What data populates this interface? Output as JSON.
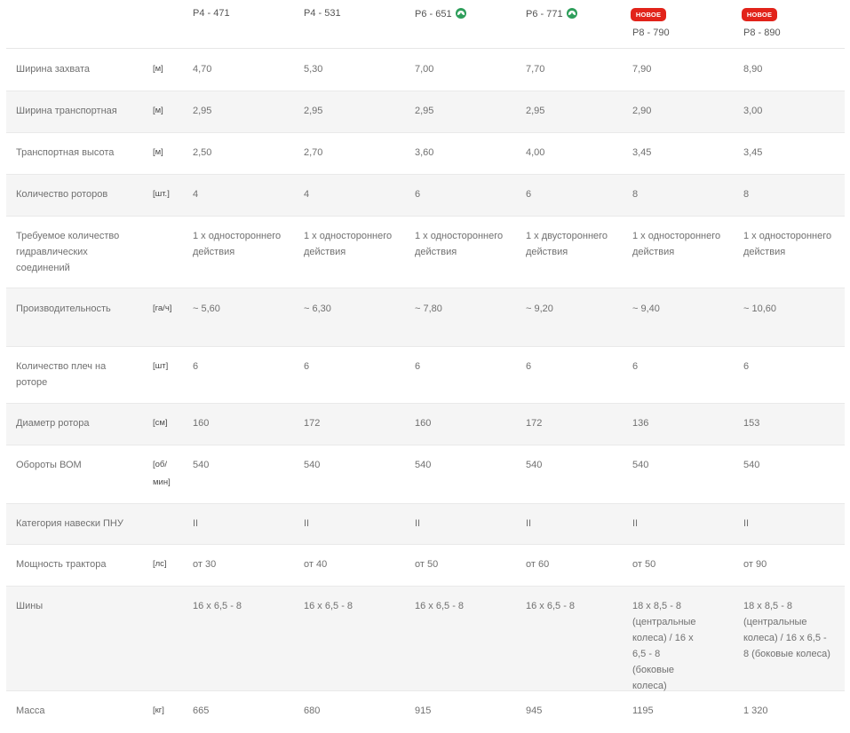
{
  "models": [
    {
      "name": "P4 - 471",
      "eco": false,
      "new": false
    },
    {
      "name": "P4 - 531",
      "eco": false,
      "new": false
    },
    {
      "name": "P6 - 651",
      "eco": true,
      "new": false
    },
    {
      "name": "P6 - 771",
      "eco": true,
      "new": false
    },
    {
      "name": "P8 - 790",
      "eco": false,
      "new": true
    },
    {
      "name": "P8 - 890",
      "eco": false,
      "new": true
    }
  ],
  "new_badge_label": "НОВОЕ",
  "eco_icon": "leaf-icon",
  "accent_colors": {
    "badge": "#e2231a",
    "eco": "#2e9e5b"
  },
  "rows": [
    {
      "label": "Ширина захвата",
      "unit": "[м]",
      "values": [
        "4,70",
        "5,30",
        "7,00",
        "7,70",
        "7,90",
        "8,90"
      ]
    },
    {
      "label": "Ширина транспортная",
      "unit": "[м]",
      "values": [
        "2,95",
        "2,95",
        "2,95",
        "2,95",
        "2,90",
        "3,00"
      ]
    },
    {
      "label": "Транспортная высота",
      "unit": "[м]",
      "values": [
        "2,50",
        "2,70",
        "3,60",
        "4,00",
        "3,45",
        "3,45"
      ]
    },
    {
      "label": "Количество роторов",
      "unit": "[шт.]",
      "values": [
        "4",
        "4",
        "6",
        "6",
        "8",
        "8"
      ]
    },
    {
      "label": "Требуемое количество гидравлических соединений",
      "unit": "",
      "values": [
        "1 x одностороннего действия",
        "1 x одностороннего действия",
        "1 x одностороннего действия",
        "1 x двустороннего действия",
        "1 x одностороннего действия",
        "1 x одностороннего действия"
      ]
    },
    {
      "label": "Производительность",
      "unit": "[га/ч]",
      "values": [
        "~ 5,60",
        "~ 6,30",
        "~ 7,80",
        "~ 9,20",
        "~ 9,40",
        "~ 10,60"
      ]
    },
    {
      "label": "Количество плеч на роторе",
      "unit": "[шт]",
      "values": [
        "6",
        "6",
        "6",
        "6",
        "6",
        "6"
      ]
    },
    {
      "label": "Диаметр ротора",
      "unit": "[см]",
      "values": [
        "160",
        "172",
        "160",
        "172",
        "136",
        "153"
      ]
    },
    {
      "label": "Обороты ВОМ",
      "unit": "[об/мин]",
      "values": [
        "540",
        "540",
        "540",
        "540",
        "540",
        "540"
      ]
    },
    {
      "label": "Категория навески ПНУ",
      "unit": "",
      "values": [
        "II",
        "II",
        "II",
        "II",
        "II",
        "II"
      ]
    },
    {
      "label": "Мощность трактора",
      "unit": "[лс]",
      "values": [
        "от 30",
        "от 40",
        "от 50",
        "от 60",
        "от 50",
        "от 90"
      ]
    },
    {
      "label": "Шины",
      "unit": "",
      "values": [
        "16 x 6,5 - 8",
        "16 x 6,5 - 8",
        "16 x 6,5 - 8",
        "16 x 6,5 - 8",
        "18 x 8,5 - 8 (центральные колеса) / 16 x 6,5 - 8 (боковые колеса)",
        "18 x 8,5 - 8 (центральные колеса) / 16 x 6,5 - 8 (боковые колеса)"
      ]
    },
    {
      "label": "Масса",
      "unit": "[кг]",
      "values": [
        "665",
        "680",
        "915",
        "945",
        "1195",
        "1 320"
      ]
    }
  ]
}
